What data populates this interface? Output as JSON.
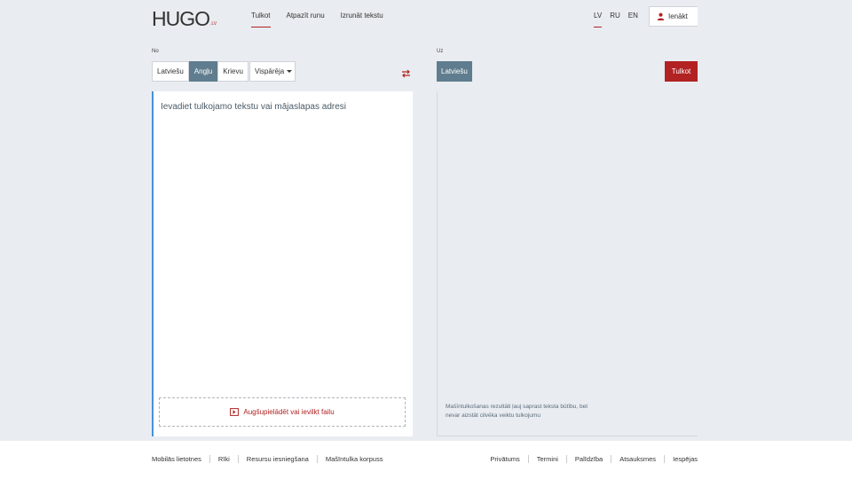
{
  "header": {
    "logo_main": "HUGO",
    "logo_sub": ".LV",
    "nav": [
      {
        "label": "Tulkot",
        "active": true
      },
      {
        "label": "Atpazīt runu",
        "active": false
      },
      {
        "label": "Izrunāt tekstu",
        "active": false
      }
    ],
    "langs": [
      {
        "label": "LV",
        "active": true
      },
      {
        "label": "RU",
        "active": false
      },
      {
        "label": "EN",
        "active": false
      }
    ],
    "login_label": "Ienākt"
  },
  "source": {
    "section_label": "No",
    "languages": [
      {
        "label": "Latviešu",
        "active": false
      },
      {
        "label": "Angļu",
        "active": true
      },
      {
        "label": "Krievu",
        "active": false
      }
    ],
    "domain_selected": "Vispārēja",
    "placeholder": "Ievadiet tulkojamo tekstu vai mājaslapas adresi",
    "upload_label": "Augšupielādēt vai ievilkt failu"
  },
  "target": {
    "section_label": "Uz",
    "language": "Latviešu",
    "translate_label": "Tulkot",
    "disclaimer": "Mašīntulkošanas rezultāti ļauj saprast teksta būtību, bet nevar aizstāt cilvēka veiktu tulkojumu"
  },
  "footer": {
    "left_links": [
      "Mobilās lietotnes",
      "Rīki",
      "Resursu iesniegšana",
      "Mašīntulka korpuss"
    ],
    "right_links": [
      "Privātums",
      "Termini",
      "Palīdzība",
      "Atsauksmes",
      "Iespējas"
    ]
  },
  "colors": {
    "accent": "#b22222",
    "selected": "#5f7d8e",
    "background": "#e9ecf0"
  }
}
